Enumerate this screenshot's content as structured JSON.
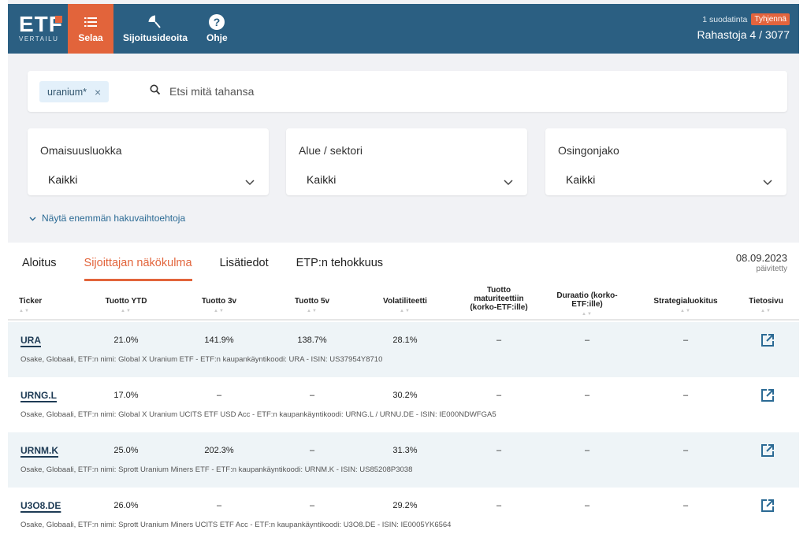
{
  "header": {
    "logo_text": "ETF",
    "logo_sub": "VERTAILU",
    "nav": [
      {
        "label": "Selaa",
        "icon": "list-icon"
      },
      {
        "label": "Sijoitusideoita",
        "icon": "beach-umbrella-icon"
      },
      {
        "label": "Ohje",
        "icon": "help-icon"
      }
    ],
    "filter_count": "1 suodatinta",
    "clear_label": "Tyhjennä",
    "funds_count": "Rahastoja 4 / 3077"
  },
  "search": {
    "chip_label": "uranium*",
    "chip_remove": "×",
    "placeholder": "Etsi mitä tahansa"
  },
  "filters": [
    {
      "label": "Omaisuusluokka",
      "value": "Kaikki"
    },
    {
      "label": "Alue / sektori",
      "value": "Kaikki"
    },
    {
      "label": "Osingonjako",
      "value": "Kaikki"
    }
  ],
  "more_options": "Näytä enemmän hakuvaihtoehtoja",
  "tabs": [
    "Aloitus",
    "Sijoittajan näkökulma",
    "Lisätiedot",
    "ETP:n tehokkuus"
  ],
  "updated": {
    "date": "08.09.2023",
    "label": "päivitetty"
  },
  "columns": [
    "Ticker",
    "Tuotto YTD",
    "Tuotto 3v",
    "Tuotto 5v",
    "Volatiliteetti",
    "Tuotto maturiteettiin (korko-ETF:ille)",
    "Duraatio (korko-ETF:ille)",
    "Strategialuokitus",
    "Tietosivu"
  ],
  "rows": [
    {
      "ticker": "URA",
      "ytd": "21.0%",
      "y3": "141.9%",
      "y5": "138.7%",
      "vol": "28.1%",
      "ytm": "–",
      "dur": "–",
      "strat": "–",
      "desc": "Osake, Globaali, ETF:n nimi: Global X Uranium ETF - ETF:n kaupankäyntikoodi: URA - ISIN: US37954Y8710"
    },
    {
      "ticker": "URNG.L",
      "ytd": "17.0%",
      "y3": "–",
      "y5": "–",
      "vol": "30.2%",
      "ytm": "–",
      "dur": "–",
      "strat": "–",
      "desc": "Osake, Globaali, ETF:n nimi: Global X Uranium UCITS ETF USD Acc - ETF:n kaupankäyntikoodi: URNG.L / URNU.DE - ISIN: IE000NDWFGA5"
    },
    {
      "ticker": "URNM.K",
      "ytd": "25.0%",
      "y3": "202.3%",
      "y5": "–",
      "vol": "31.3%",
      "ytm": "–",
      "dur": "–",
      "strat": "–",
      "desc": "Osake, Globaali, ETF:n nimi: Sprott Uranium Miners ETF - ETF:n kaupankäyntikoodi: URNM.K - ISIN: US85208P3038"
    },
    {
      "ticker": "U3O8.DE",
      "ytd": "26.0%",
      "y3": "–",
      "y5": "–",
      "vol": "29.2%",
      "ytm": "–",
      "dur": "–",
      "strat": "–",
      "desc": "Osake, Globaali, ETF:n nimi: Sprott Uranium Miners UCITS ETF Acc - ETF:n kaupankäyntikoodi: U3O8.DE - ISIN: IE0005YK6564"
    }
  ],
  "colors": {
    "header": "#2b5f82",
    "accent": "#e2643b",
    "alt_row": "#eef4f7"
  }
}
